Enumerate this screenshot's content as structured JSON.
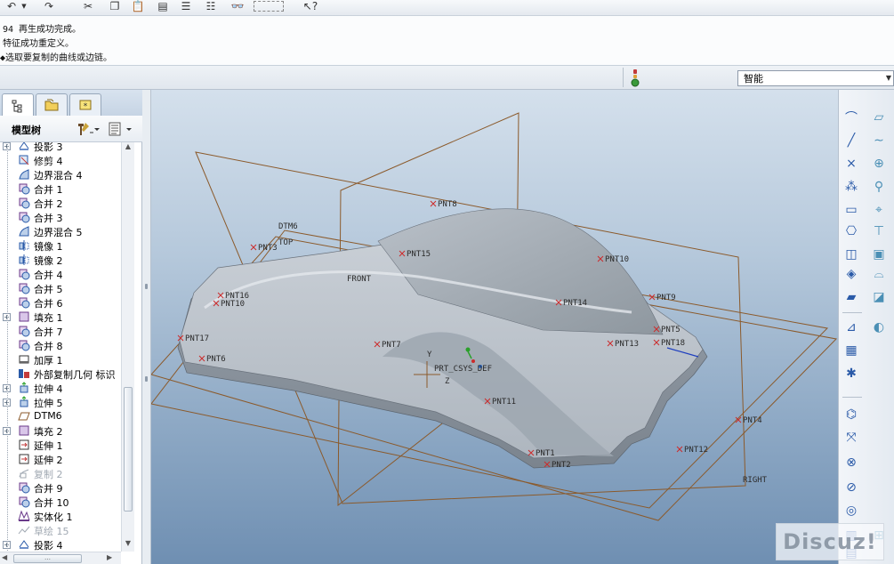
{
  "toolbar": {
    "icons": [
      "undo-icon",
      "undo-dropdown-icon",
      "redo-icon",
      "cut-icon",
      "copy-icon",
      "paste-icon",
      "paste-special-icon",
      "regenerate-icon",
      "regenerate-manager-icon",
      "find-icon",
      "select-box-icon",
      "context-help-icon"
    ]
  },
  "messages": [
    "94 再生成功完成。",
    "特征成功重定义。",
    "◆选取要复制的曲线或边链。"
  ],
  "status": {
    "filter_value": "智能",
    "accent": "#3a9a3a"
  },
  "panel": {
    "tabs": [
      "model-tree-tab",
      "folder-browser-tab",
      "favorites-tab"
    ],
    "title": "模型树"
  },
  "tree": {
    "items": [
      {
        "label": "投影 3",
        "icon": "projection",
        "expand": true
      },
      {
        "label": "修剪 4",
        "icon": "trim",
        "expand": false
      },
      {
        "label": "边界混合 4",
        "icon": "boundary-blend",
        "expand": false
      },
      {
        "label": "合并 1",
        "icon": "merge",
        "expand": false
      },
      {
        "label": "合并 2",
        "icon": "merge",
        "expand": false
      },
      {
        "label": "合并 3",
        "icon": "merge",
        "expand": false
      },
      {
        "label": "边界混合 5",
        "icon": "boundary-blend",
        "expand": false
      },
      {
        "label": "镜像 1",
        "icon": "mirror",
        "expand": false
      },
      {
        "label": "镜像 2",
        "icon": "mirror",
        "expand": false
      },
      {
        "label": "合并 4",
        "icon": "merge",
        "expand": false
      },
      {
        "label": "合并 5",
        "icon": "merge",
        "expand": false
      },
      {
        "label": "合并 6",
        "icon": "merge",
        "expand": false
      },
      {
        "label": "填充 1",
        "icon": "fill",
        "expand": true
      },
      {
        "label": "合并 7",
        "icon": "merge",
        "expand": false
      },
      {
        "label": "合并 8",
        "icon": "merge",
        "expand": false
      },
      {
        "label": "加厚 1",
        "icon": "thicken",
        "expand": false
      },
      {
        "label": "外部复制几何 标识",
        "icon": "external-copy",
        "expand": false
      },
      {
        "label": "拉伸 4",
        "icon": "extrude",
        "expand": true
      },
      {
        "label": "拉伸 5",
        "icon": "extrude",
        "expand": true
      },
      {
        "label": "DTM6",
        "icon": "datum-plane",
        "expand": false
      },
      {
        "label": "填充 2",
        "icon": "fill",
        "expand": true
      },
      {
        "label": "延伸 1",
        "icon": "extend",
        "expand": false
      },
      {
        "label": "延伸 2",
        "icon": "extend",
        "expand": false
      },
      {
        "label": "复制 2",
        "icon": "copy",
        "expand": false,
        "dim": true
      },
      {
        "label": "合并 9",
        "icon": "merge",
        "expand": false
      },
      {
        "label": "合并 10",
        "icon": "merge",
        "expand": false
      },
      {
        "label": "实体化 1",
        "icon": "solidify",
        "expand": false
      },
      {
        "label": "草绘 15",
        "icon": "sketch",
        "expand": false,
        "dim": true
      },
      {
        "label": "投影 4",
        "icon": "projection",
        "expand": true
      }
    ]
  },
  "scroll": {
    "hthumb": "…"
  },
  "graphics": {
    "datum_planes": [
      "DTM6",
      "TOP",
      "FRONT",
      "RIGHT"
    ],
    "csys": "PRT_CSYS_DEF",
    "points": [
      "PNT8",
      "PNT15",
      "PNT10",
      "PNT9",
      "PNT14",
      "PNT5",
      "PNT18",
      "PNT13",
      "PNT7",
      "PNT11",
      "PNT4",
      "PNT12",
      "PNT2",
      "PNT1",
      "PNT16",
      "PNT17",
      "PNT6",
      "PNT3",
      "PNT10b"
    ],
    "point_labels": {
      "pnt8": "PNT8",
      "pnt15": "PNT15",
      "pnt10": "PNT10",
      "pnt9": "PNT9",
      "pnt14": "PNT14",
      "pnt5": "PNT5",
      "pnt18": "PNT18",
      "pnt13": "PNT13",
      "pnt7": "PNT7",
      "pnt11": "PNT11",
      "pnt4": "PNT4",
      "pnt12": "PNT12",
      "pnt2": "PNT2",
      "pnt1": "PNT1",
      "pnt16": "PNT16",
      "pnt17": "PNT17",
      "pnt6": "PNT6",
      "pnt3": "PNT3",
      "pnt10b": "PNT10"
    },
    "plane_color": "#8b5a2b",
    "point_color": "#cc2b2b"
  },
  "right_tools": [
    "datum-plane-icon",
    "datum-axis-icon",
    "datum-curve-icon",
    "sketch-curve-icon",
    "datum-point-icon",
    "offset-point-icon",
    "field-point-icon",
    "csys-icon",
    "analysis-icon",
    "annotation-icon",
    "analysis-feature-icon",
    "extrude-icon",
    "revolve-icon",
    "sweep-icon",
    "blend-icon",
    "hole-icon",
    "round-icon",
    "shell-icon",
    "draft-icon",
    "mirror-icon",
    "pattern-icon",
    "merge-icon",
    "trim-icon",
    "extend-icon",
    "intersect-icon",
    "project-icon",
    "offset-icon",
    "thicken-icon",
    "solidify-icon",
    "fill-icon"
  ],
  "watermark": "Discuz!"
}
